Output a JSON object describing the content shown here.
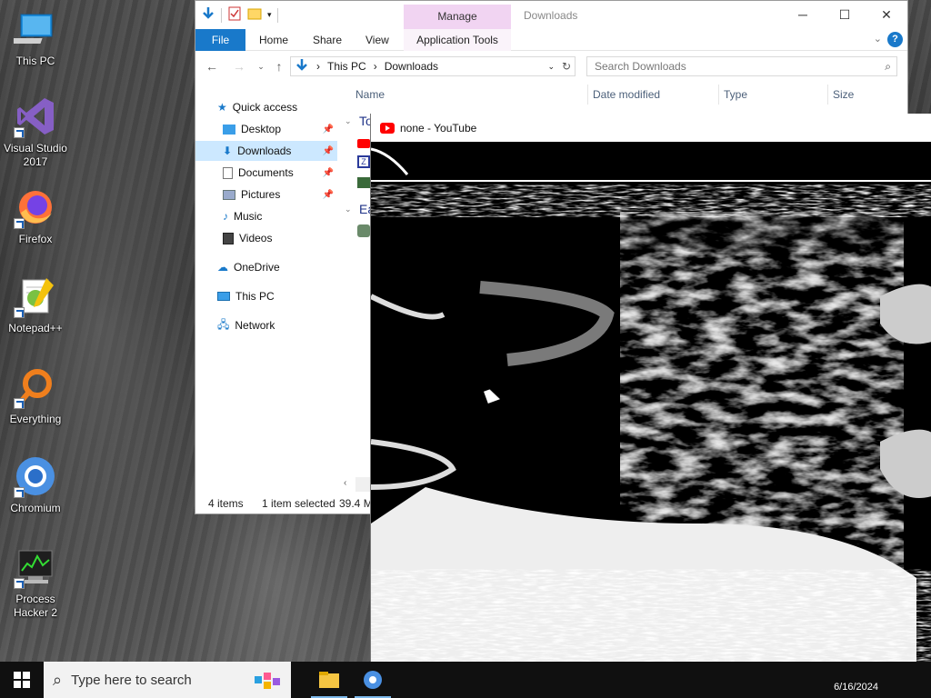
{
  "desktop": {
    "icons": [
      {
        "label_line1": "This PC",
        "label_line2": "",
        "icon": "this-pc-icon"
      },
      {
        "label_line1": "Visual Studio",
        "label_line2": "2017",
        "icon": "visual-studio-icon"
      },
      {
        "label_line1": "Firefox",
        "label_line2": "",
        "icon": "firefox-icon"
      },
      {
        "label_line1": "Notepad++",
        "label_line2": "",
        "icon": "notepadpp-icon"
      },
      {
        "label_line1": "Everything",
        "label_line2": "",
        "icon": "everything-icon"
      },
      {
        "label_line1": "Chromium",
        "label_line2": "",
        "icon": "chromium-icon"
      },
      {
        "label_line1": "Process",
        "label_line2": "Hacker 2",
        "icon": "process-hacker-icon"
      }
    ]
  },
  "explorer": {
    "title": "Downloads",
    "manage_tab": "Manage",
    "ribbon_tabs": [
      "File",
      "Home",
      "Share",
      "View",
      "Application Tools"
    ],
    "address": {
      "segment1": "This PC",
      "segment2": "Downloads",
      "sep": "›"
    },
    "search_placeholder": "Search Downloads",
    "columns": [
      "Name",
      "Date modified",
      "Type",
      "Size"
    ],
    "groups": [
      "To",
      "Ea"
    ],
    "nav": {
      "quick_access": "Quick access",
      "desktop": "Desktop",
      "downloads": "Downloads",
      "documents": "Documents",
      "pictures": "Pictures",
      "music": "Music",
      "videos": "Videos",
      "onedrive": "OneDrive",
      "this_pc": "This PC",
      "network": "Network"
    },
    "status": {
      "items": "4 items",
      "selected": "1 item selected",
      "size": "39.4 M"
    }
  },
  "youtube": {
    "title": "none - YouTube"
  },
  "taskbar": {
    "search_placeholder": "Type here to search",
    "clock_date": "6/16/2024"
  },
  "colors": {
    "accent": "#1979ca",
    "manage_tab": "#f1d4f2",
    "selection": "#cce8ff",
    "youtube_red": "#ff0000"
  }
}
